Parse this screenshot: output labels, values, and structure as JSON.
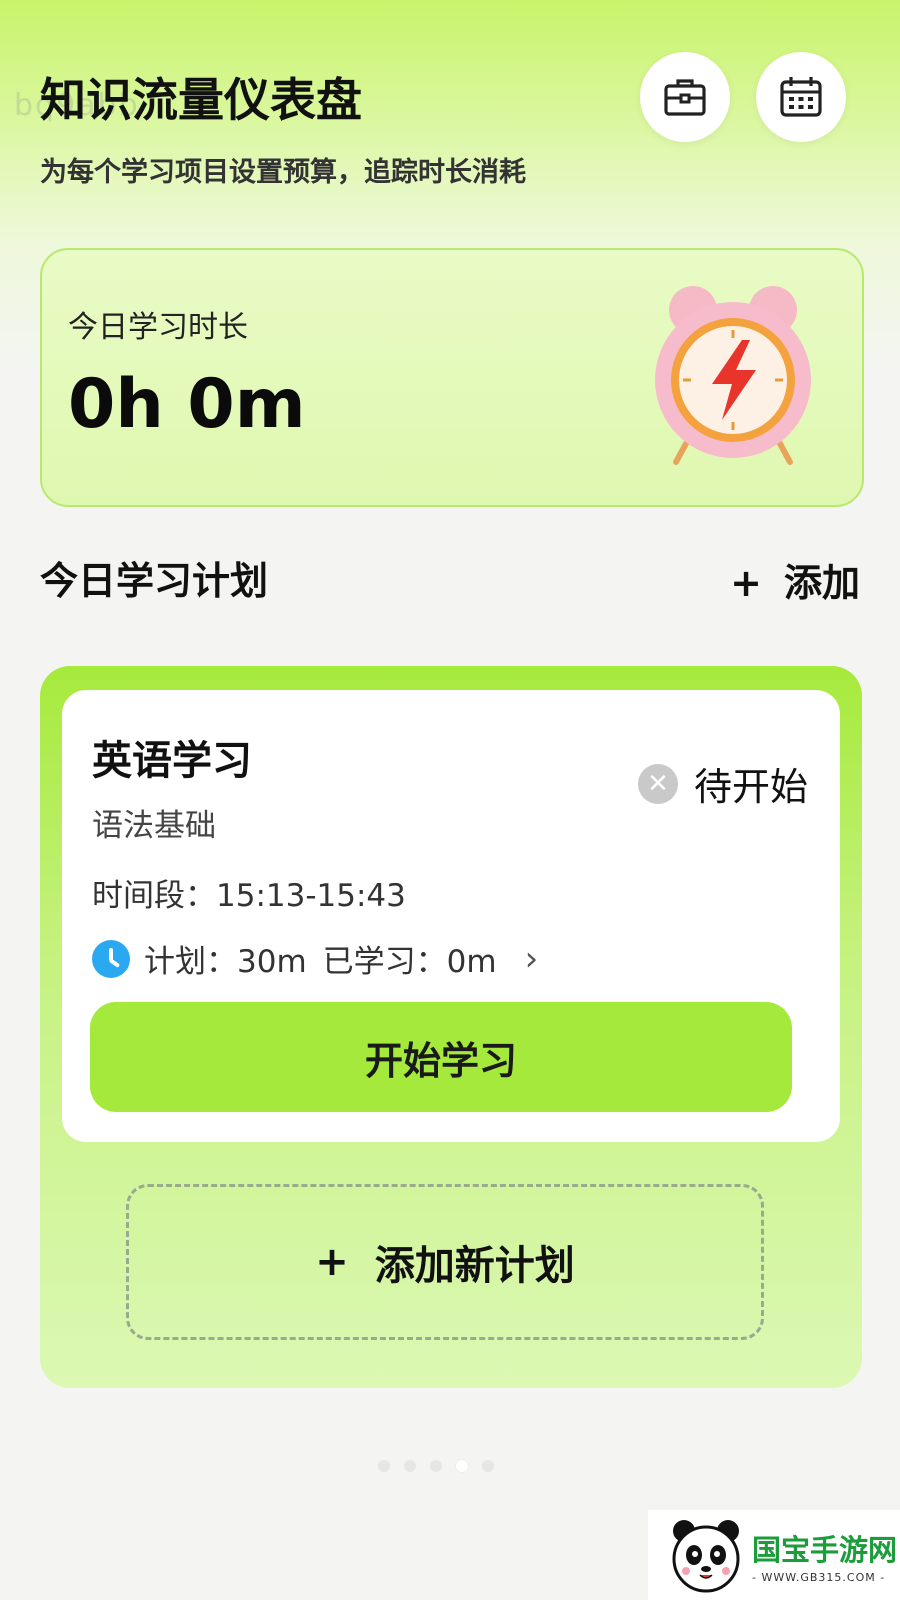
{
  "header": {
    "ghost_text": "bq9abb",
    "title": "知识流量仪表盘",
    "subtitle": "为每个学习项目设置预算，追踪时长消耗",
    "icons": [
      "briefcase-icon",
      "calendar-icon"
    ]
  },
  "stats": {
    "label": "今日学习时长",
    "value": "0h 0m"
  },
  "plans": {
    "section_title": "今日学习计划",
    "add_plus": "+",
    "add_label": "添加",
    "items": [
      {
        "name": "英语学习",
        "subtitle": "语法基础",
        "status": "待开始",
        "time_range": "时间段：15:13-15:43",
        "plan_label": "计划：30m",
        "learned_label": "已学习：0m",
        "start_button": "开始学习"
      }
    ],
    "add_new_plus": "+",
    "add_new_label": "添加新计划"
  },
  "watermark": {
    "name": "国宝手游网",
    "url": "- WWW.GB315.COM -"
  },
  "colors": {
    "accent": "#a4e93b",
    "clock_blue": "#2aa8f0"
  }
}
